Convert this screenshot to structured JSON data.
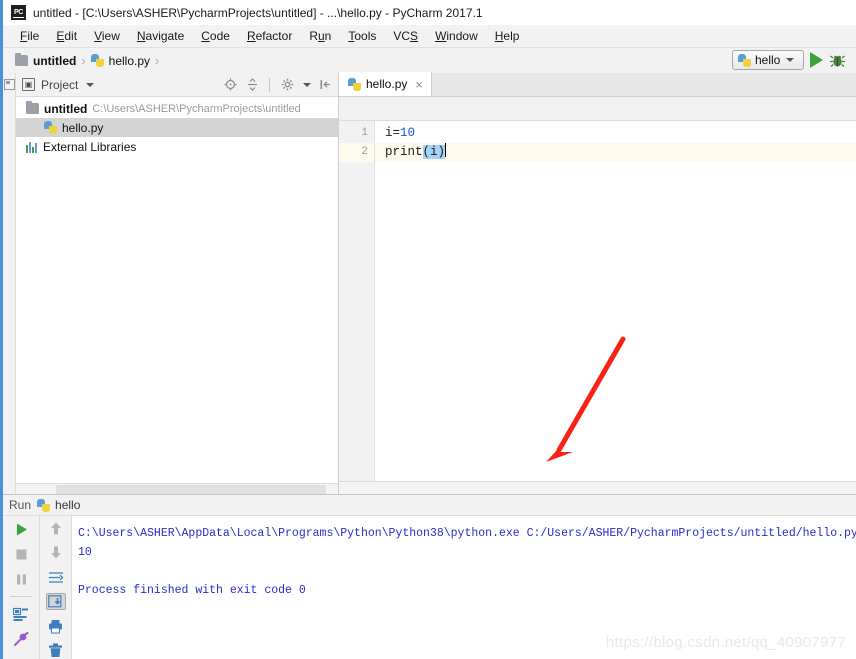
{
  "window": {
    "app_icon": "pycharm-logo-icon",
    "title": "untitled - [C:\\Users\\ASHER\\PycharmProjects\\untitled] - ...\\hello.py - PyCharm 2017.1"
  },
  "menubar": {
    "items": [
      {
        "label": "File",
        "mnemonic": "F"
      },
      {
        "label": "Edit",
        "mnemonic": "E"
      },
      {
        "label": "View",
        "mnemonic": "V"
      },
      {
        "label": "Navigate",
        "mnemonic": "N"
      },
      {
        "label": "Code",
        "mnemonic": "C"
      },
      {
        "label": "Refactor",
        "mnemonic": "R"
      },
      {
        "label": "Run",
        "mnemonic": "u"
      },
      {
        "label": "Tools",
        "mnemonic": "T"
      },
      {
        "label": "VCS",
        "mnemonic": "S"
      },
      {
        "label": "Window",
        "mnemonic": "W"
      },
      {
        "label": "Help",
        "mnemonic": "H"
      }
    ]
  },
  "navbar": {
    "breadcrumbs": [
      {
        "label": "untitled",
        "icon": "folder-icon"
      },
      {
        "label": "hello.py",
        "icon": "python-file-icon"
      }
    ],
    "separator": "›",
    "run_config": {
      "label": "hello",
      "icon": "python-file-icon"
    },
    "run_button": "run-button",
    "debug_button": "debug-button"
  },
  "project_panel": {
    "title": "Project",
    "toolbar": [
      {
        "name": "locate-file-icon"
      },
      {
        "name": "collapse-all-icon"
      },
      {
        "name": "settings-gear-icon"
      },
      {
        "name": "hide-panel-icon"
      }
    ],
    "tree": [
      {
        "label": "untitled",
        "path": "C:\\Users\\ASHER\\PycharmProjects\\untitled",
        "icon": "folder-icon",
        "bold": true,
        "selected": false,
        "indent": false
      },
      {
        "label": "hello.py",
        "path": "",
        "icon": "python-file-icon",
        "bold": false,
        "selected": true,
        "indent": true
      },
      {
        "label": "External Libraries",
        "path": "",
        "icon": "libraries-icon",
        "bold": false,
        "selected": false,
        "indent": false
      }
    ]
  },
  "editor": {
    "tabs": [
      {
        "label": "hello.py",
        "icon": "python-file-icon",
        "active": true,
        "close": "×"
      }
    ],
    "lines": [
      {
        "number": "1",
        "prefix": "i=",
        "number_token": "10",
        "suffix": "",
        "highlighted": false
      },
      {
        "number": "2",
        "prefix": "print",
        "number_token": "",
        "suffix": "(i)",
        "highlighted": true
      }
    ],
    "code_line_1": "i=10",
    "code_line_2": "print(i)",
    "line_numbers": [
      "1",
      "2"
    ]
  },
  "run_window": {
    "tab_label": "Run",
    "config_name": "hello",
    "config_icon": "python-file-icon",
    "left_toolbar": [
      {
        "name": "rerun-button"
      },
      {
        "name": "stop-button"
      },
      {
        "name": "pause-button"
      },
      {
        "name": "console-toggle-button"
      },
      {
        "name": "pin-tab-button"
      }
    ],
    "right_toolbar": [
      {
        "name": "scroll-up-button"
      },
      {
        "name": "scroll-down-button"
      },
      {
        "name": "soft-wrap-button"
      },
      {
        "name": "scroll-to-end-button"
      },
      {
        "name": "print-button"
      },
      {
        "name": "clear-all-button"
      }
    ],
    "console": {
      "command": "C:\\Users\\ASHER\\AppData\\Local\\Programs\\Python\\Python38\\python.exe C:/Users/ASHER/PycharmProjects/untitled/hello.py",
      "output": "10",
      "exit_message": "Process finished with exit code 0"
    }
  },
  "annotation": {
    "arrow": "red-arrow-annotation",
    "color": "#fa2216"
  },
  "watermark": {
    "text": "https://blog.csdn.net/qq_40907977"
  },
  "colors": {
    "accent_blue": "#4a90d9",
    "run_green": "#3aa33a",
    "console_text": "#2b2bcc",
    "keyword_blue": "#1750eb",
    "selection_blue": "#a6d2f5",
    "line_highlight": "#fdf9ec"
  }
}
